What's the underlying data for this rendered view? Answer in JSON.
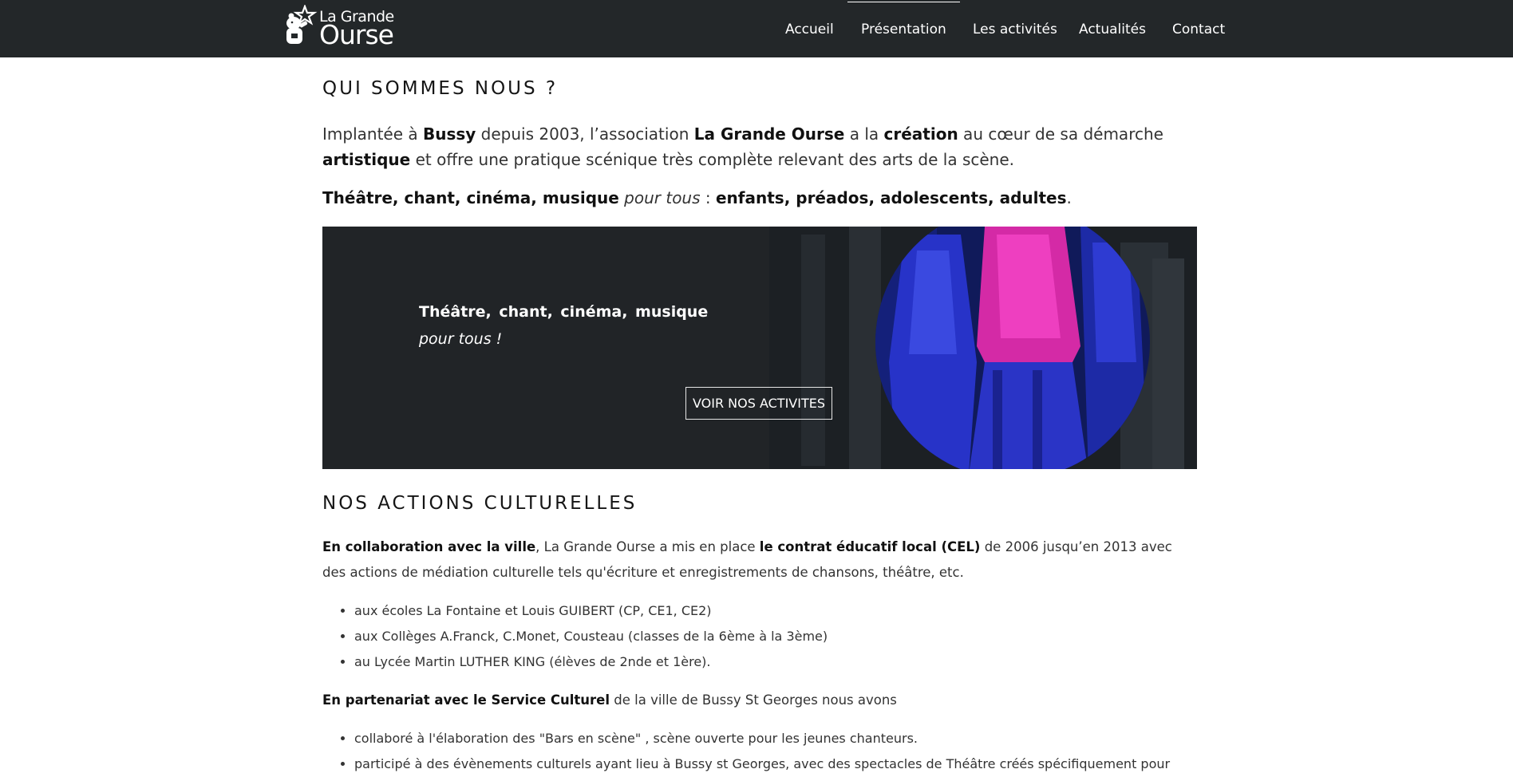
{
  "brand": {
    "name_line1": "La Grande",
    "name_line2": "Ourse"
  },
  "nav": {
    "items": [
      {
        "label": "Accueil",
        "active": false
      },
      {
        "label": "Présentation",
        "active": true
      },
      {
        "label": "Les activités",
        "active": false
      },
      {
        "label": "Actualités",
        "active": false
      },
      {
        "label": "Contact",
        "active": false
      }
    ]
  },
  "section1": {
    "title": "QUI SOMMES NOUS ?",
    "intro": {
      "p1": "Implantée à ",
      "b1": "Bussy",
      "p2": " depuis 2003, l’association ",
      "b2": "La Grande Ourse",
      "p3": " a la ",
      "b3": "création",
      "p4": " au cœur de sa démarche ",
      "b4": "artistique",
      "p5": " et offre une pratique scénique très complète relevant des arts de la scène."
    },
    "tagline": {
      "b1": "Théâtre, chant, cinéma, musique",
      "i1": " pour tous",
      "p1": " : ",
      "b2": "enfants, préados, adolescents, adultes",
      "p2": "."
    }
  },
  "banner": {
    "line1": "Théâtre,  chant,  cinéma,  musique",
    "line2": "pour tous !",
    "button_label": "VOIR NOS ACTIVITES",
    "photo_icon": "theatre-performers-photo"
  },
  "section2": {
    "title": "NOS ACTIONS CULTURELLES",
    "para1": {
      "b1": "En collaboration avec la ville",
      "p1": ", La Grande Ourse a mis en place ",
      "b2": "le contrat éducatif local (CEL)",
      "p2": " de 2006 jusqu’en 2013 avec des actions de médiation culturelle tels qu'écriture et enregistrements de chansons, théâtre, etc."
    },
    "list1": [
      "aux écoles La Fontaine et Louis GUIBERT (CP, CE1, CE2)",
      "aux Collèges A.Franck, C.Monet, Cousteau (classes de la 6ème à la 3ème)",
      "au Lycée Martin LUTHER KING (élèves de 2nde et 1ère)."
    ],
    "para2": {
      "b1": "En partenariat avec le Service Culturel",
      "p1": " de la ville de Bussy St Georges nous avons"
    },
    "list2": [
      "collaboré à l'élaboration des \"Bars en scène\" , scène ouverte pour les jeunes chanteurs.",
      "participé à des évènements culturels ayant lieu à Bussy st Georges, avec des spectacles de Théâtre créés spécifiquement pour"
    ]
  },
  "colors": {
    "header_bg": "#232729",
    "banner_bg": "#212427",
    "accent_magenta": "#d42aa6",
    "accent_blue": "#2330c9"
  }
}
